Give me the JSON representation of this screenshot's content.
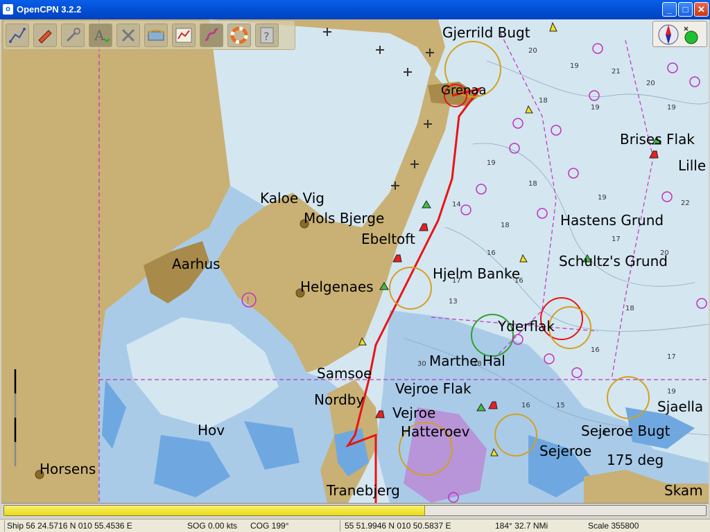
{
  "window": {
    "title": "OpenCPN 3.2.2",
    "icon": "opencpn-icon",
    "buttons": {
      "minimize": "_",
      "maximize": "□",
      "close": "✕"
    }
  },
  "toolbar": {
    "tools": [
      {
        "name": "route-tool",
        "icon": "route-icon"
      },
      {
        "name": "ship-tool",
        "icon": "ship-icon"
      },
      {
        "name": "settings-tool",
        "icon": "wrench-icon"
      },
      {
        "name": "text-tool",
        "icon": "text-icon"
      },
      {
        "name": "chart-quilt-tool",
        "icon": "cross-tools-icon"
      },
      {
        "name": "tides-tool",
        "icon": "tides-icon"
      },
      {
        "name": "route-manager-tool",
        "icon": "route-manager-icon"
      },
      {
        "name": "track-tool",
        "icon": "track-icon"
      },
      {
        "name": "mob-tool",
        "icon": "lifebuoy-icon"
      },
      {
        "name": "help-tool",
        "icon": "help-icon"
      }
    ]
  },
  "status_icons": {
    "compass": "compass-icon",
    "gps": "gps-status-icon"
  },
  "map": {
    "labels": [
      "Gjerrild Bugt",
      "Grenaa",
      "Brises Flak",
      "Lille",
      "Kaloe Vig",
      "Mols Bjerge",
      "Ebeltoft",
      "Hastens Grund",
      "Aarhus",
      "Schultz's Grund",
      "Hjelm Banke",
      "Helgenaes",
      "Yderflak",
      "Marthe Hal",
      "Samsoe",
      "Vejroe Flak",
      "Nordby",
      "Vejroe",
      "Sjaella",
      "Hov",
      "Hatteroev",
      "Sejeroe Bugt",
      "Sejeroe",
      "175 deg",
      "Horsens",
      "Tranebjerg",
      "Skam"
    ],
    "colors": {
      "land": "#c9b074",
      "shallow": "#6fa8e0",
      "medium": "#a9cbe8",
      "deep": "#d4e6f0",
      "route": "#e81414",
      "boundary": "#c030c0"
    }
  },
  "progress": {
    "value": 0.6
  },
  "statusbar": {
    "ship": "Ship 56 24.5716 N   010 55.4536 E",
    "sog": "SOG 0.00 kts",
    "cog": "COG 199°",
    "cursor": "55 51.9946 N   010 50.5837 E",
    "bearing": "184°  32.7 NMi",
    "scale": "Scale 355800"
  }
}
